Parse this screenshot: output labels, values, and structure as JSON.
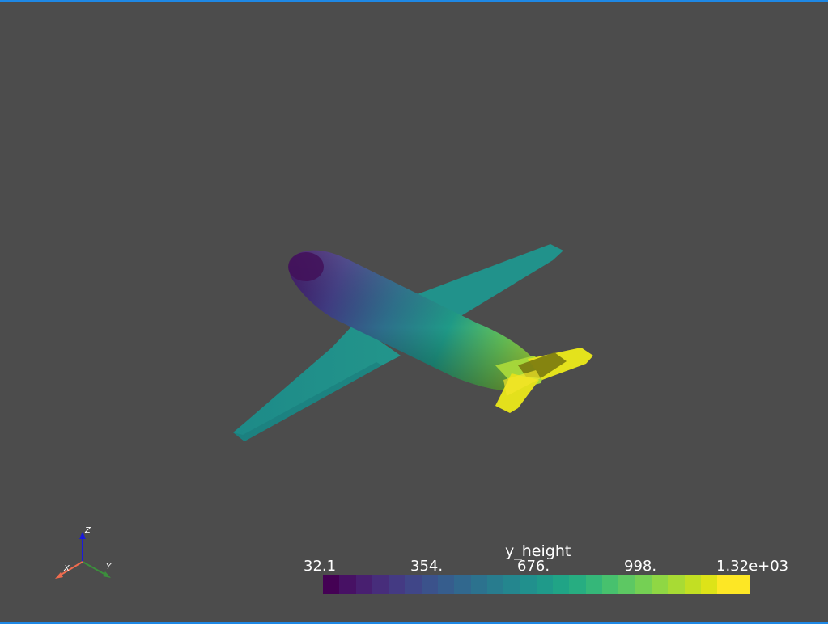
{
  "scalar_bar": {
    "title": "y_height",
    "ticks": [
      "32.1",
      "354.",
      "676.",
      "998.",
      "1.32e+03"
    ],
    "colors": [
      "#440154",
      "#471164",
      "#481f70",
      "#472d7b",
      "#443a83",
      "#404688",
      "#3b528b",
      "#365d8d",
      "#31688e",
      "#2c728e",
      "#287c8e",
      "#24868e",
      "#21908d",
      "#1f9a8a",
      "#20a486",
      "#27ad81",
      "#35b779",
      "#47c16e",
      "#5dc863",
      "#75d054",
      "#8fd744",
      "#a8db34",
      "#c2df23",
      "#dde318",
      "#fde725",
      "#fde725"
    ]
  },
  "axes": {
    "x": "X",
    "y": "Y",
    "z": "Z"
  },
  "colors": {
    "background": "#4c4c4c",
    "frame_border": "#1e88e5",
    "axis_x": "#ef6c4f",
    "axis_y": "#3c8f3c",
    "axis_z": "#1a1adc"
  }
}
